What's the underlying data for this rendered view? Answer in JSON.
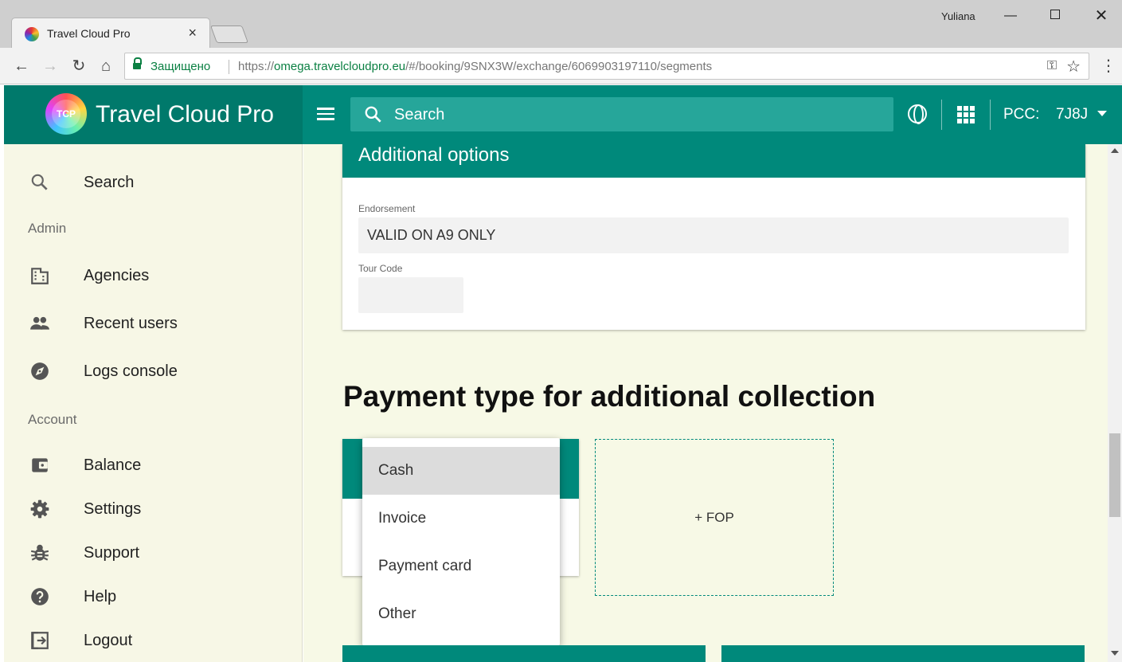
{
  "browser": {
    "tab_title": "Travel Cloud Pro",
    "window_user": "Yuliana",
    "secure_label": "Защищено",
    "url_scheme": "https://",
    "url_host": "omega.travelcloudpro.eu",
    "url_path": "/#/booking/9SNX3W/exchange/6069903197110/segments"
  },
  "header": {
    "app_title": "Travel Cloud Pro",
    "logo_text": "TCP",
    "search_placeholder": "Search",
    "pcc_label": "PCC:",
    "pcc_value": "7J8J"
  },
  "sidebar": {
    "search_label": "Search",
    "admin_section": "Admin",
    "agencies_label": "Agencies",
    "recent_users_label": "Recent users",
    "logs_console_label": "Logs console",
    "account_section": "Account",
    "balance_label": "Balance",
    "settings_label": "Settings",
    "support_label": "Support",
    "help_label": "Help",
    "logout_label": "Logout"
  },
  "main": {
    "additional_options": {
      "title": "Additional options",
      "endorsement_label": "Endorsement",
      "endorsement_value": "VALID ON A9 ONLY",
      "tour_code_label": "Tour Code",
      "tour_code_value": ""
    },
    "payment_section_title": "Payment type for additional collection",
    "add_fop_label": "+ FOP",
    "payment_dropdown": {
      "selected": "Cash",
      "options": [
        "Cash",
        "Invoice",
        "Payment card",
        "Other"
      ]
    }
  },
  "colors": {
    "primary": "#00897b",
    "primary_dark": "#00796b",
    "sidebar_bg": "#f7f7e6",
    "content_bg": "#f7f9e6"
  },
  "icons": [
    "search-icon",
    "building-icon",
    "people-icon",
    "compass-icon",
    "wallet-icon",
    "gear-icon",
    "bug-icon",
    "help-icon",
    "logout-icon",
    "globe-icon",
    "apps-grid-icon",
    "menu-icon"
  ]
}
